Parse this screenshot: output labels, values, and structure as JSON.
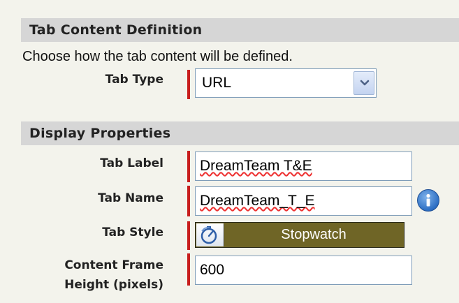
{
  "sections": {
    "content_definition": {
      "title": "Tab Content Definition",
      "intro": "Choose how the tab content will be defined.",
      "tab_type": {
        "label": "Tab Type",
        "value": "URL"
      }
    },
    "display_properties": {
      "title": "Display Properties",
      "tab_label": {
        "label": "Tab Label",
        "value": "DreamTeam T&E"
      },
      "tab_name": {
        "label": "Tab Name",
        "value": "DreamTeam_T_E"
      },
      "tab_style": {
        "label": "Tab Style",
        "value": "Stopwatch",
        "icon": "stopwatch-icon"
      },
      "frame_height": {
        "label_line1": "Content Frame",
        "label_line2": "Height (pixels)",
        "value": "600"
      }
    }
  },
  "colors": {
    "section_header_bg": "#d6d6d6",
    "required_marker": "#c81e1e",
    "tab_style_bg": "#6f6526",
    "page_bg": "#f3f3ec"
  }
}
